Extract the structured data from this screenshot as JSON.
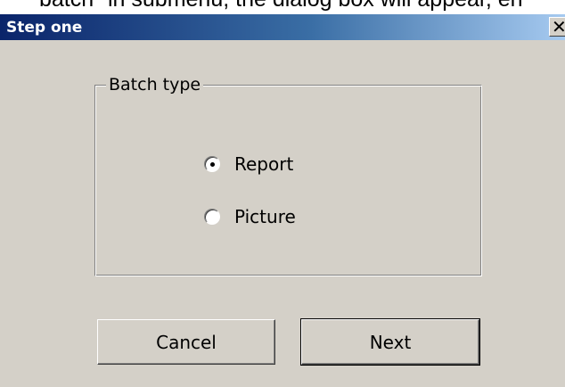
{
  "background_text": "batch\" in submenu, the dialog box will appear, en",
  "dialog": {
    "title": "Step one",
    "close_glyph": "✕"
  },
  "group": {
    "label": "Batch type",
    "options": [
      {
        "label": "Report",
        "selected": true
      },
      {
        "label": "Picture",
        "selected": false
      }
    ]
  },
  "buttons": {
    "cancel_label": "Cancel",
    "next_label": "Next"
  },
  "colors": {
    "dialog_bg": "#d4d0c8",
    "titlebar_start": "#0a246a",
    "titlebar_end": "#a6caf0"
  }
}
